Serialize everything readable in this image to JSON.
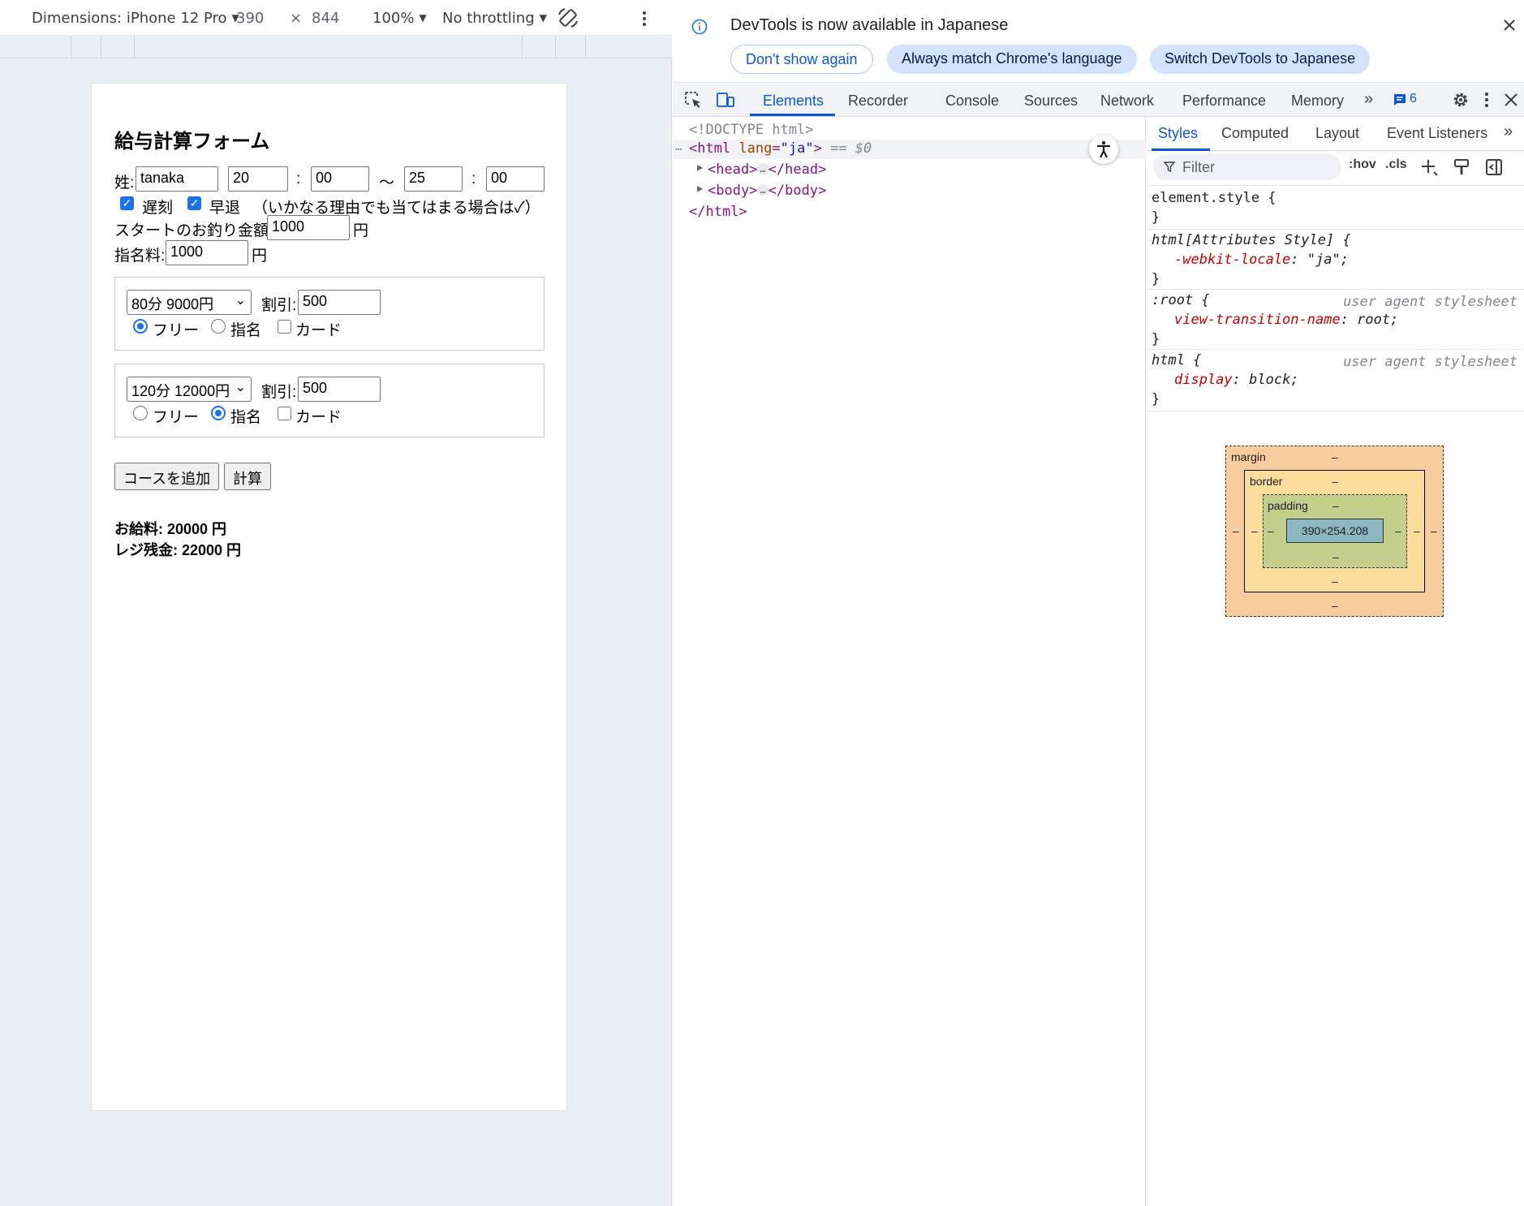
{
  "device_toolbar": {
    "dimensions_label": "Dimensions: iPhone 12 Pro",
    "width": "390",
    "times": "×",
    "height": "844",
    "zoom": "100%",
    "throttling": "No throttling"
  },
  "page": {
    "title": "給与計算フォーム",
    "name_label": "姓:",
    "name_value": "tanaka",
    "start_hour": "20",
    "colon": ":",
    "start_min": "00",
    "tilde": "〜",
    "end_hour": "25",
    "end_min": "00",
    "late_label": "遅刻",
    "early_label": "早退",
    "note": "（いかなる理由でも当てはまる場合は✓）",
    "change_label": "スタートのお釣り金額:",
    "change_value": "1000",
    "yen": "円",
    "nomination_label": "指名料:",
    "nomination_value": "1000",
    "courses": [
      {
        "select": "80分 9000円",
        "discount_label": "割引:",
        "discount": "500",
        "free": "フリー",
        "nominate": "指名",
        "card": "カード"
      },
      {
        "select": "120分 12000円",
        "discount_label": "割引:",
        "discount": "500",
        "free": "フリー",
        "nominate": "指名",
        "card": "カード"
      }
    ],
    "add_course_button": "コースを追加",
    "calc_button": "計算",
    "salary": "お給料: 20000 円",
    "register": "レジ残金: 22000 円"
  },
  "devtools": {
    "info_text": "DevTools is now available in Japanese",
    "btn_dont_show": "Don't show again",
    "btn_match": "Always match Chrome's language",
    "btn_switch": "Switch DevTools to Japanese",
    "tabs": [
      "Elements",
      "Recorder",
      "Console",
      "Sources",
      "Network",
      "Performance",
      "Memory"
    ],
    "issues_count": "6",
    "dom": {
      "doctype": "<!DOCTYPE html>",
      "html_open": "<html",
      "lang_attr": "lang",
      "lang_val": "\"ja\"",
      "html_close_bracket": ">",
      "selected_marker": "== $0",
      "head_open": "<head>",
      "head_close": "</head>",
      "body_open": "<body>",
      "body_close": "</body>",
      "html_close": "</html>",
      "ellipsis": "…"
    },
    "styles_tabs": [
      "Styles",
      "Computed",
      "Layout",
      "Event Listeners"
    ],
    "filter_placeholder": "Filter",
    "hov": ":hov",
    "cls": ".cls",
    "rules": {
      "element_style": "element.style {",
      "close": "}",
      "attr_selector": "html[Attributes Style] {",
      "locale_prop": "-webkit-locale",
      "locale_val": ": \"ja\";",
      "root_selector": ":root {",
      "ua_label": "user agent stylesheet",
      "vt_prop": "view-transition-name",
      "vt_val": ": root;",
      "html_selector": "html {",
      "display_prop": "display",
      "display_val": ": block;"
    },
    "box_model": {
      "margin": "margin",
      "border": "border",
      "padding": "padding",
      "content": "390×254.208",
      "dash": "–"
    }
  }
}
